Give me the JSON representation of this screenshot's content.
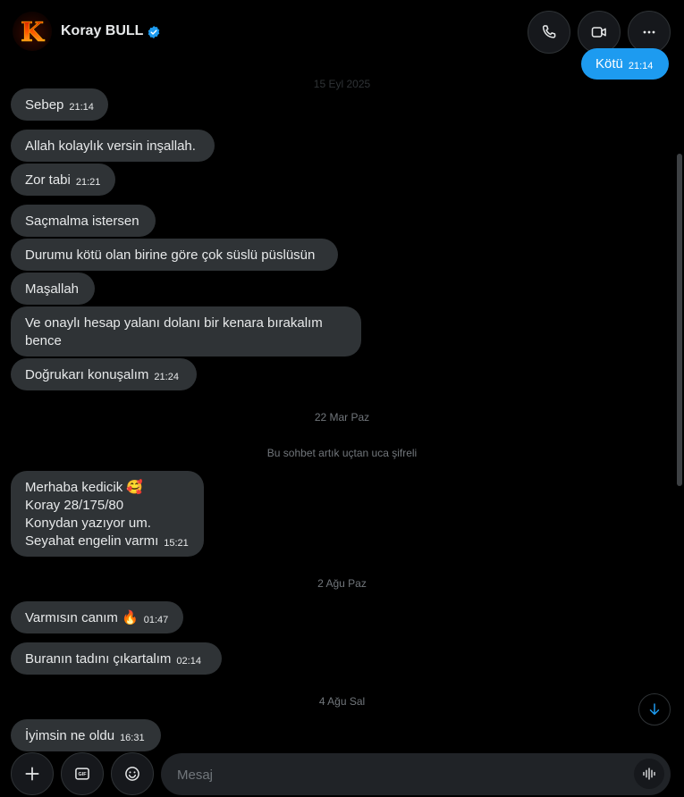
{
  "contact": {
    "name": "Koray BULL",
    "avatar_letter": "K"
  },
  "header": {
    "call_icon": "phone-icon",
    "video_icon": "video-icon",
    "more_icon": "more-icon"
  },
  "outgoing": {
    "text": "Kötü",
    "time": "21:14"
  },
  "separators": {
    "date_faded": "15 Eyl 2025",
    "date_1": "22 Mar Paz",
    "encrypted": "Bu sohbet artık uçtan uca şifreli",
    "date_2": "2 Ağu Paz",
    "date_3": "4 Ağu Sal"
  },
  "messages": [
    {
      "text": "Sebep",
      "time": "21:14"
    },
    {
      "text": "Allah kolaylık versin inşallah.",
      "time": ""
    },
    {
      "text": "Zor tabi",
      "time": "21:21"
    },
    {
      "text": "Saçmalma istersen",
      "time": ""
    },
    {
      "text": "Durumu kötü olan birine göre çok süslü püslüsün",
      "time": ""
    },
    {
      "text": "Maşallah",
      "time": ""
    },
    {
      "text": "Ve onaylı hesap yalanı dolanı bir kenara bırakalım bence",
      "time": ""
    },
    {
      "text": "Doğrukarı konuşalım",
      "time": "21:24"
    },
    {
      "line1": "Merhaba kedicik 🥰",
      "line2": "Koray 28/175/80",
      "line3": "Konydan yazıyor um.",
      "line4": "Seyahat engelin varmı",
      "time": "15:21"
    },
    {
      "text": "Varmısın canım 🔥",
      "time": "01:47"
    },
    {
      "text": "Buranın tadını çıkartalım",
      "time": "02:14"
    },
    {
      "text": "İyimsin ne oldu",
      "time": "16:31"
    }
  ],
  "composer": {
    "placeholder": "Mesaj",
    "add_icon": "plus-icon",
    "gif_label": "GIF",
    "emoji_icon": "emoji-icon",
    "voice_icon": "voice-icon"
  },
  "colors": {
    "accent": "#1d9bf0",
    "bubble": "#2f3336",
    "background": "#000000"
  }
}
